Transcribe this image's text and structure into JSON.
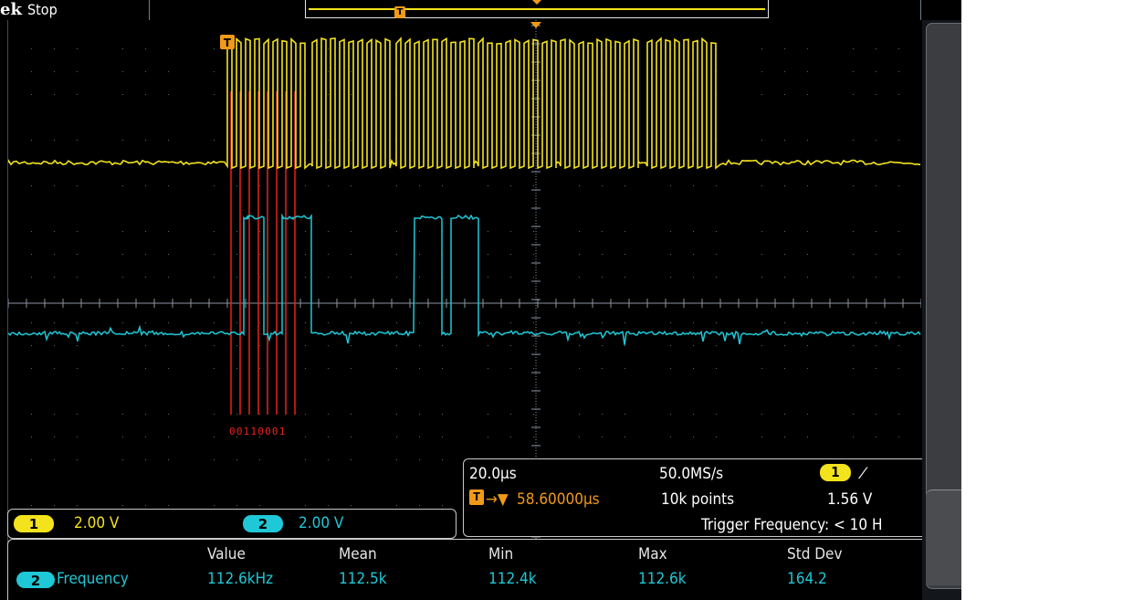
{
  "top_bar": {
    "brand": "ek",
    "run_state": "Stop"
  },
  "decode": {
    "bits": "00110001"
  },
  "vertical": {
    "ch1": {
      "number": "1",
      "scale": "2.00 V",
      "color": "#f3e31c"
    },
    "ch2": {
      "number": "2",
      "scale": "2.00 V",
      "color": "#1fc8d6"
    }
  },
  "horizontal": {
    "time_per_div": "20.0µs",
    "sample_rate": "50.0MS/s",
    "trigger_channel": "1",
    "trigger_slope_icon": "rising-edge-icon",
    "trigger_slope_glyph": "⁄",
    "trigger_position_icon": "trigger-arrow-icon",
    "trigger_position": "58.60000µs",
    "record_length": "10k points",
    "trigger_level": "1.56 V",
    "trigger_frequency": "Trigger Frequency: < 10 H"
  },
  "measurements": {
    "headers": [
      "Value",
      "Mean",
      "Min",
      "Max",
      "Std Dev"
    ],
    "rows": [
      {
        "channel": "2",
        "name": "Frequency",
        "value": "112.6kHz",
        "mean": "112.5k",
        "min": "112.4k",
        "max": "112.6k",
        "std_dev": "164.2"
      }
    ]
  },
  "colors": {
    "ch1": "#f3e31c",
    "ch2": "#1fc8d6",
    "trigger": "#f09a17",
    "decode_marker": "#e8231f",
    "graticule": "#5a6a78"
  }
}
